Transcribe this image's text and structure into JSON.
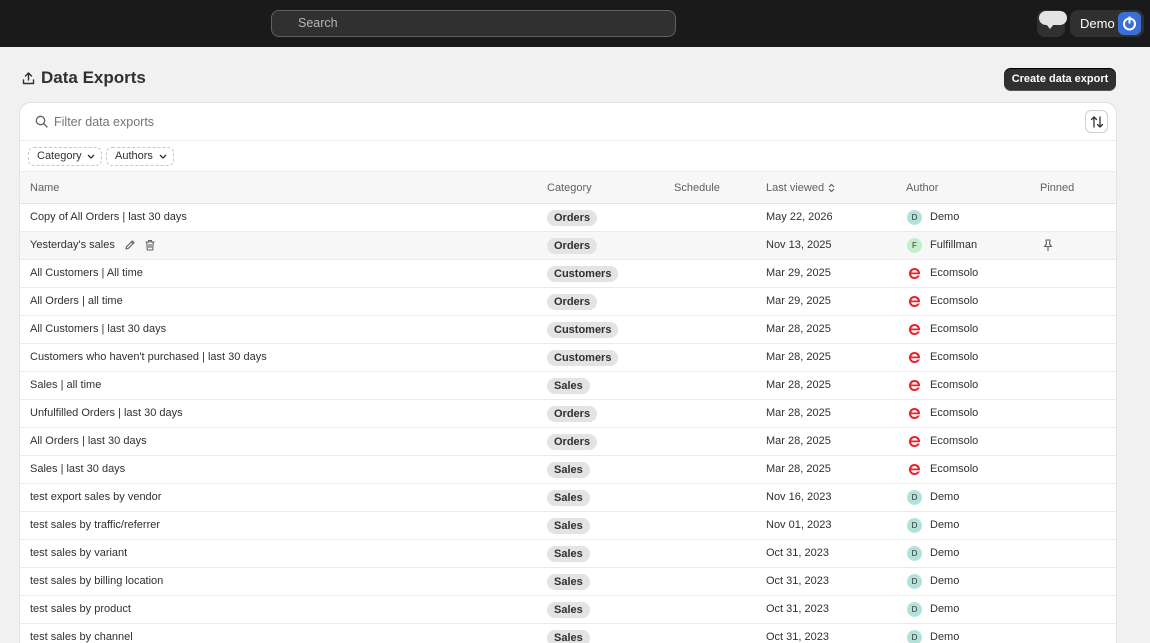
{
  "topbar": {
    "search_placeholder": "Search",
    "user_name": "Demo"
  },
  "page": {
    "title": "Data Exports",
    "create_button": "Create data export"
  },
  "filter": {
    "placeholder": "Filter data exports"
  },
  "chips": {
    "category": "Category",
    "authors": "Authors"
  },
  "columns": {
    "name": "Name",
    "category": "Category",
    "schedule": "Schedule",
    "last_viewed": "Last viewed",
    "author": "Author",
    "pinned": "Pinned"
  },
  "colors": {
    "topbar": "#1a1a1a",
    "primary_button": "#303030",
    "demo_avatar": "#b3e2dc",
    "fulfillman_avatar": "#c4efc9",
    "ecomsolo_logo": "#e3262b"
  },
  "rows": [
    {
      "name": "Copy of All Orders | last 30 days",
      "category": "Orders",
      "schedule": "",
      "last_viewed": "May 22, 2026",
      "author": "Demo",
      "initial": "D",
      "avatar": "demo"
    },
    {
      "name": "Yesterday's sales",
      "category": "Orders",
      "schedule": "",
      "last_viewed": "Nov 13, 2025",
      "author": "Fulfillman",
      "initial": "F",
      "avatar": "full"
    },
    {
      "name": "All Customers | All time",
      "category": "Customers",
      "schedule": "",
      "last_viewed": "Mar 29, 2025",
      "author": "Ecomsolo",
      "initial": "",
      "avatar": "eco"
    },
    {
      "name": "All Orders | all time",
      "category": "Orders",
      "schedule": "",
      "last_viewed": "Mar 29, 2025",
      "author": "Ecomsolo",
      "initial": "",
      "avatar": "eco"
    },
    {
      "name": "All Customers | last 30 days",
      "category": "Customers",
      "schedule": "",
      "last_viewed": "Mar 28, 2025",
      "author": "Ecomsolo",
      "initial": "",
      "avatar": "eco"
    },
    {
      "name": "Customers who haven't purchased | last 30 days",
      "category": "Customers",
      "schedule": "",
      "last_viewed": "Mar 28, 2025",
      "author": "Ecomsolo",
      "initial": "",
      "avatar": "eco"
    },
    {
      "name": "Sales | all time",
      "category": "Sales",
      "schedule": "",
      "last_viewed": "Mar 28, 2025",
      "author": "Ecomsolo",
      "initial": "",
      "avatar": "eco"
    },
    {
      "name": "Unfulfilled Orders | last 30 days",
      "category": "Orders",
      "schedule": "",
      "last_viewed": "Mar 28, 2025",
      "author": "Ecomsolo",
      "initial": "",
      "avatar": "eco"
    },
    {
      "name": "All Orders | last 30 days",
      "category": "Orders",
      "schedule": "",
      "last_viewed": "Mar 28, 2025",
      "author": "Ecomsolo",
      "initial": "",
      "avatar": "eco"
    },
    {
      "name": "Sales | last 30 days",
      "category": "Sales",
      "schedule": "",
      "last_viewed": "Mar 28, 2025",
      "author": "Ecomsolo",
      "initial": "",
      "avatar": "eco"
    },
    {
      "name": "test export sales by vendor",
      "category": "Sales",
      "schedule": "",
      "last_viewed": "Nov 16, 2023",
      "author": "Demo",
      "initial": "D",
      "avatar": "demo"
    },
    {
      "name": "test sales by traffic/referrer",
      "category": "Sales",
      "schedule": "",
      "last_viewed": "Nov 01, 2023",
      "author": "Demo",
      "initial": "D",
      "avatar": "demo"
    },
    {
      "name": "test sales by variant",
      "category": "Sales",
      "schedule": "",
      "last_viewed": "Oct 31, 2023",
      "author": "Demo",
      "initial": "D",
      "avatar": "demo"
    },
    {
      "name": "test sales by billing location",
      "category": "Sales",
      "schedule": "",
      "last_viewed": "Oct 31, 2023",
      "author": "Demo",
      "initial": "D",
      "avatar": "demo"
    },
    {
      "name": "test sales by product",
      "category": "Sales",
      "schedule": "",
      "last_viewed": "Oct 31, 2023",
      "author": "Demo",
      "initial": "D",
      "avatar": "demo"
    },
    {
      "name": "test sales by channel",
      "category": "Sales",
      "schedule": "",
      "last_viewed": "Oct 31, 2023",
      "author": "Demo",
      "initial": "D",
      "avatar": "demo"
    }
  ]
}
